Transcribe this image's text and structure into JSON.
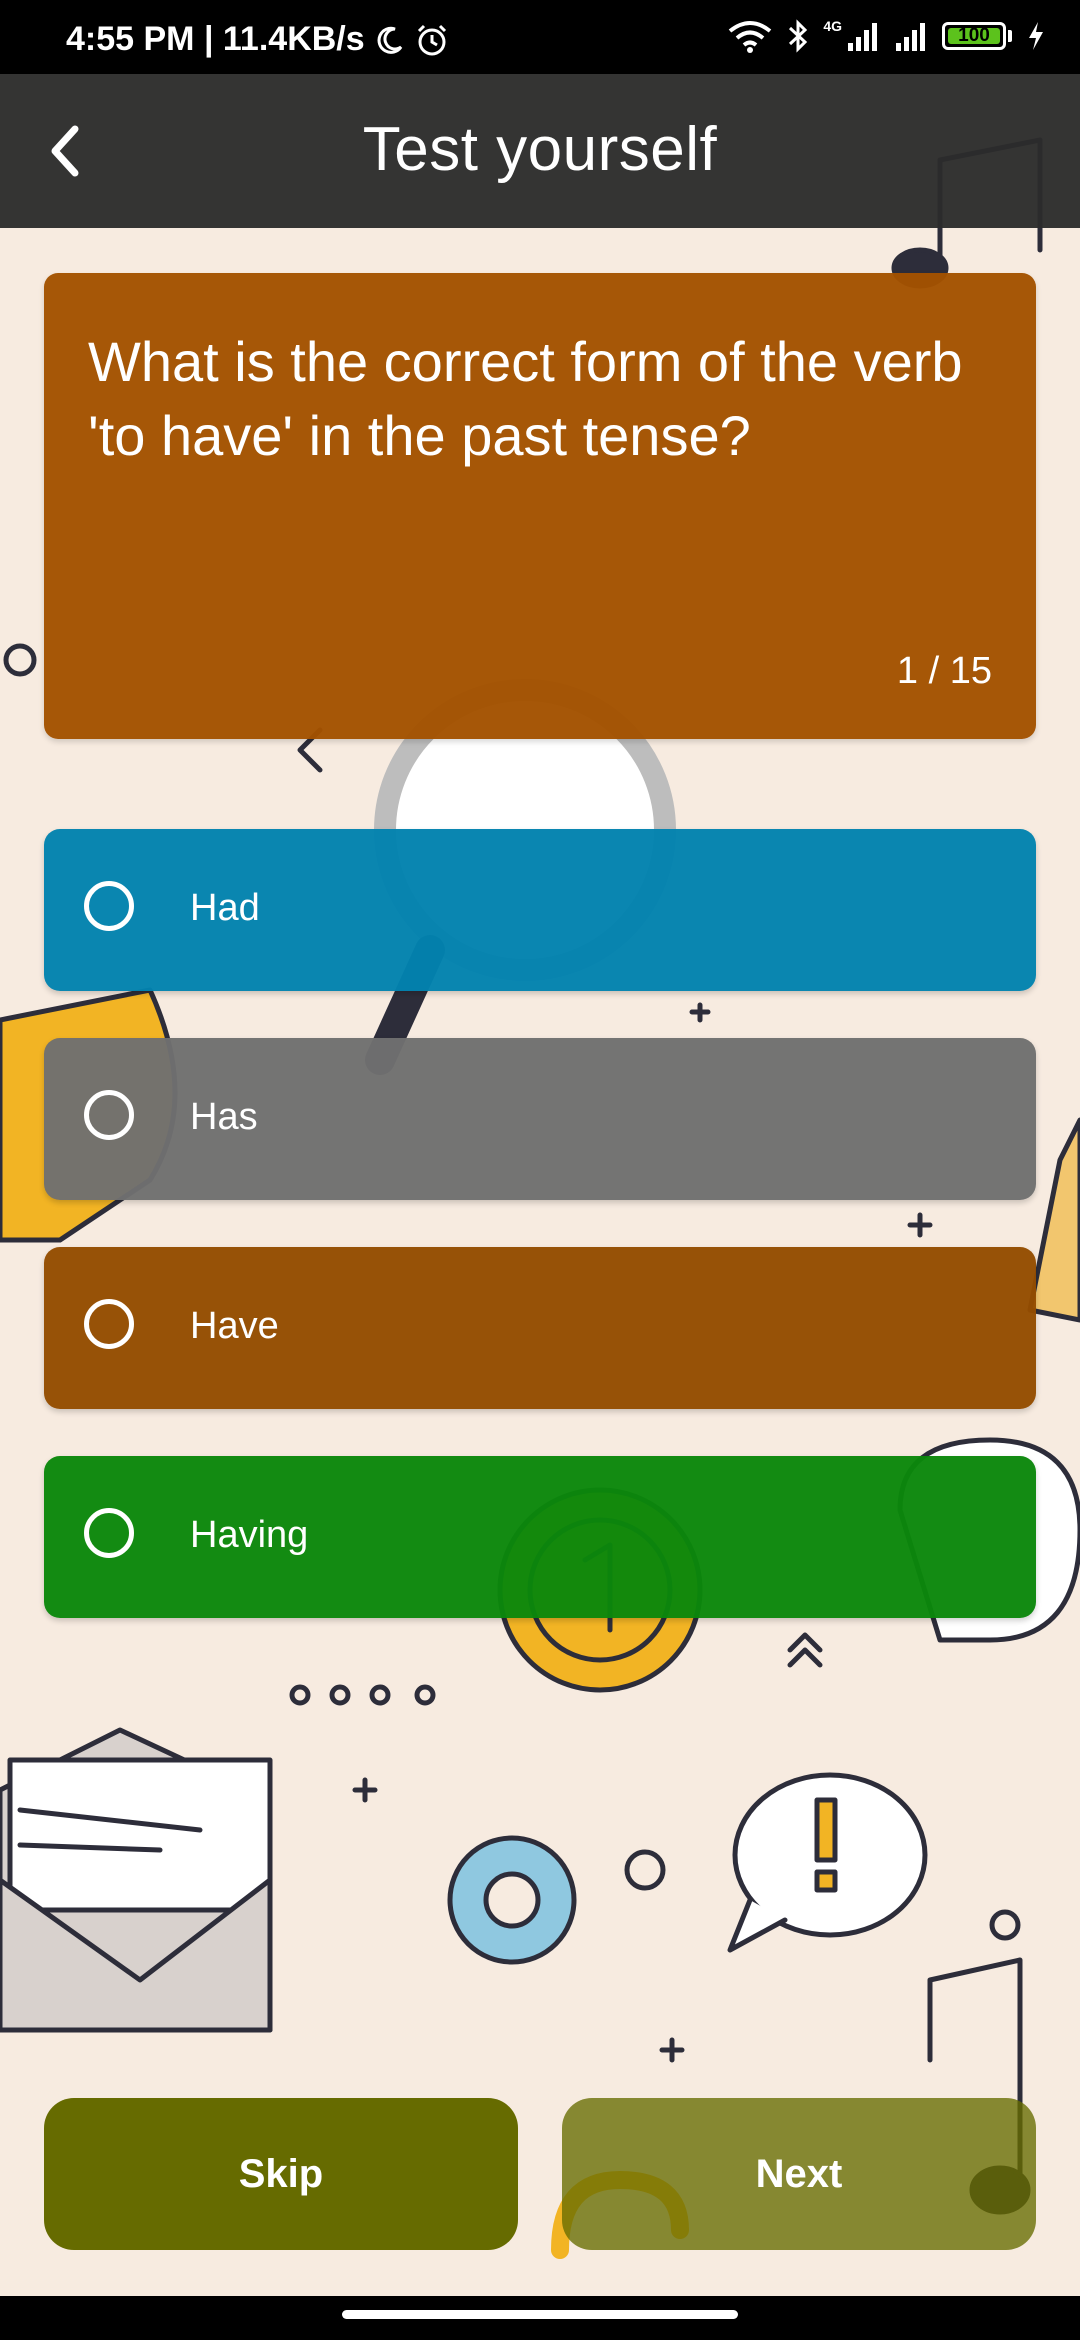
{
  "status_bar": {
    "time_speed": "4:55 PM | 11.4KB/s",
    "network_badge": "4G",
    "battery": "100",
    "icons": [
      "moon-icon",
      "alarm-icon",
      "wifi-icon",
      "bluetooth-icon",
      "signal-icon",
      "signal-icon",
      "battery-icon",
      "charging-icon"
    ]
  },
  "app_bar": {
    "back_icon": "chevron-left-icon",
    "title": "Test yourself"
  },
  "question": {
    "text": "What is the correct form of the verb 'to have' in the past tense?",
    "counter": "1 / 15"
  },
  "answers": [
    {
      "label": "Had",
      "color": "#0282ae"
    },
    {
      "label": "Has",
      "color": "#707070"
    },
    {
      "label": "Have",
      "color": "#944c00"
    },
    {
      "label": "Having",
      "color": "#0b870b"
    }
  ],
  "buttons": {
    "skip": "Skip",
    "next": "Next"
  },
  "colors": {
    "question_card": "#a35200",
    "app_bar": "#2c2c2c",
    "button": "#666b00",
    "background": "#f7ebe0"
  }
}
